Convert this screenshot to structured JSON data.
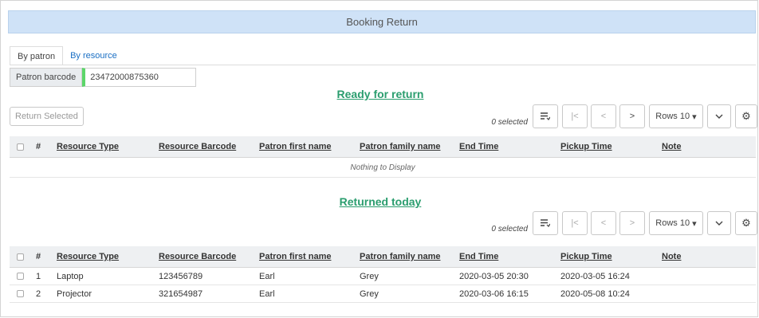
{
  "header": {
    "title": "Booking Return"
  },
  "tabs": [
    {
      "label": "By patron",
      "active": true
    },
    {
      "label": "By resource",
      "active": false
    }
  ],
  "patron": {
    "label": "Patron barcode",
    "value": "23472000875360"
  },
  "ready": {
    "title": "Ready for return",
    "return_button": "Return Selected",
    "selected_text": "0 selected",
    "rows_label": "Rows 10",
    "empty_text": "Nothing to Display"
  },
  "returned": {
    "title": "Returned today",
    "selected_text": "0 selected",
    "rows_label": "Rows 10",
    "rows": [
      {
        "num": "1",
        "type": "Laptop",
        "barcode": "123456789",
        "first": "Earl",
        "family": "Grey",
        "end": "2020-03-05 20:30",
        "pickup": "2020-03-05 16:24",
        "note": ""
      },
      {
        "num": "2",
        "type": "Projector",
        "barcode": "321654987",
        "first": "Earl",
        "family": "Grey",
        "end": "2020-03-06 16:15",
        "pickup": "2020-05-08 10:24",
        "note": ""
      }
    ]
  },
  "columns": {
    "num": "#",
    "type": "Resource Type",
    "barcode": "Resource Barcode",
    "first": "Patron first name",
    "family": "Patron family name",
    "end": "End Time",
    "pickup": "Pickup Time",
    "note": "Note"
  },
  "icons": {
    "columns": "list-columns-icon",
    "first": "first-page-icon",
    "prev": "prev-page-icon",
    "next": "next-page-icon",
    "expand": "chevron-down-icon",
    "settings": "gear-icon"
  },
  "colors": {
    "accent_green": "#2a9d6e",
    "title_bar": "#cfe2f7",
    "link_blue": "#1a6fc4",
    "input_valid": "#5cd66a"
  }
}
